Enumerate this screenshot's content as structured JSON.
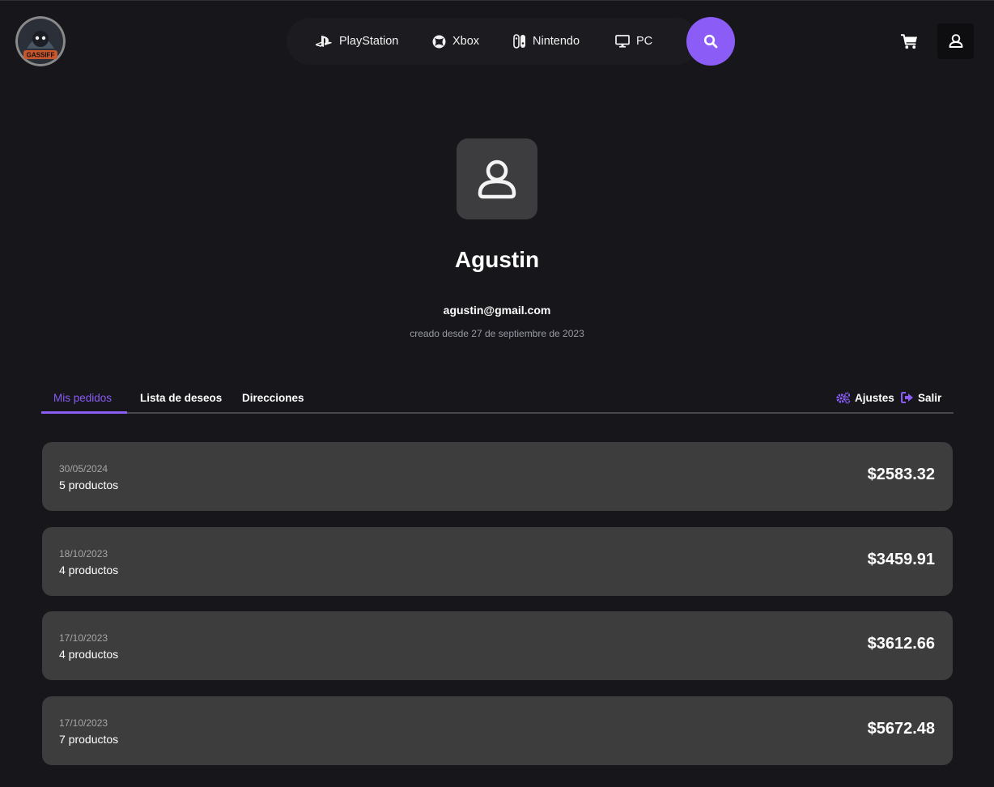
{
  "header": {
    "logo_text": "GASSIFF",
    "nav": [
      {
        "label": "PlayStation",
        "icon": "playstation-icon"
      },
      {
        "label": "Xbox",
        "icon": "xbox-icon"
      },
      {
        "label": "Nintendo",
        "icon": "nintendo-switch-icon"
      },
      {
        "label": "PC",
        "icon": "monitor-icon"
      }
    ],
    "search_icon": "search-icon",
    "cart_icon": "cart-icon",
    "user_icon": "user-icon"
  },
  "profile": {
    "name": "Agustin",
    "email": "agustin@gmail.com",
    "created": "creado desde 27 de septiembre de 2023"
  },
  "tabs": [
    {
      "label": "Mis pedidos",
      "active": true
    },
    {
      "label": "Lista de deseos",
      "active": false
    },
    {
      "label": "Direcciones",
      "active": false
    }
  ],
  "actions": {
    "settings_label": "Ajustes",
    "logout_label": "Salir"
  },
  "orders": [
    {
      "date": "30/05/2024",
      "count": "5 productos",
      "total": "$2583.32"
    },
    {
      "date": "18/10/2023",
      "count": "4 productos",
      "total": "$3459.91"
    },
    {
      "date": "17/10/2023",
      "count": "4 productos",
      "total": "$3612.66"
    },
    {
      "date": "17/10/2023",
      "count": "7 productos",
      "total": "$5672.48"
    }
  ],
  "colors": {
    "background": "#16161b",
    "accent": "#8b5cf6",
    "card": "#3d3d3d"
  }
}
